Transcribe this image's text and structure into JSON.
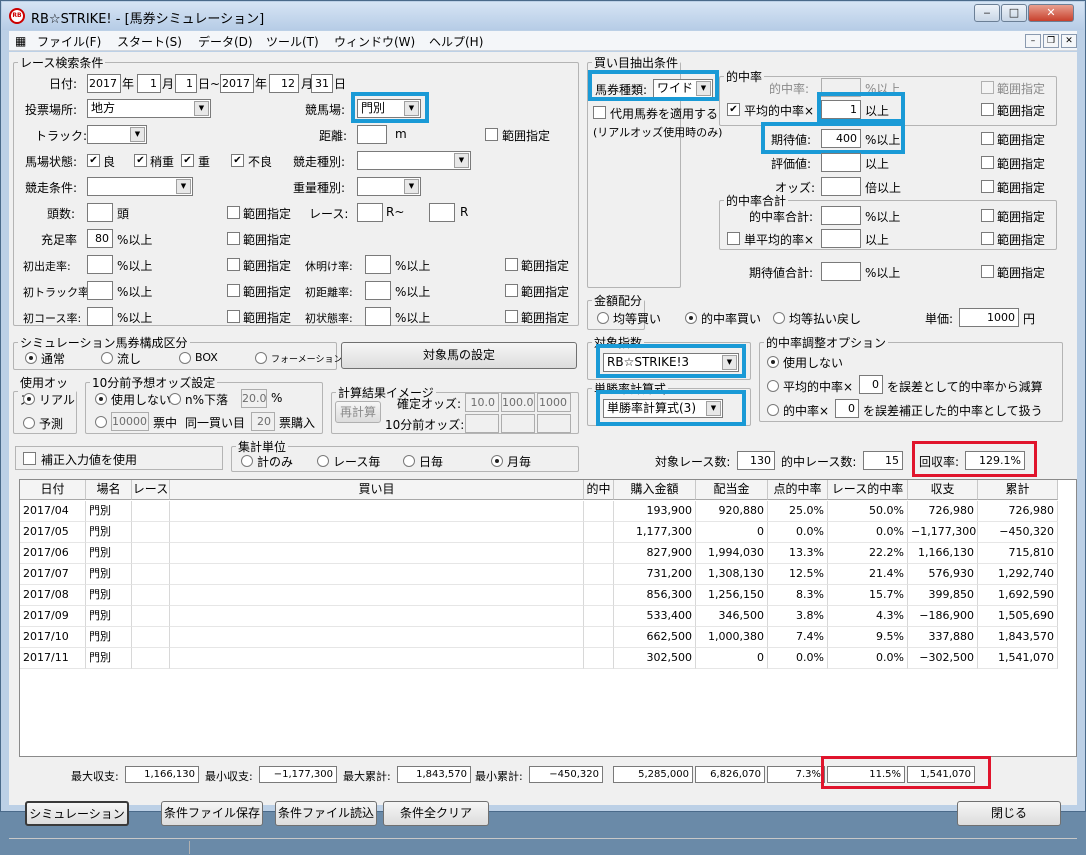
{
  "window": {
    "title": "RB☆STRIKE! - [馬券シミュレーション]",
    "app_icon": "RB"
  },
  "menu": [
    "ファイル(F)",
    "スタート(S)",
    "データ(D)",
    "ツール(T)",
    "ウィンドウ(W)",
    "ヘルプ(H)"
  ],
  "race": {
    "legend": "レース検索条件",
    "date_label": "日付:",
    "from_year": "2017",
    "from_month": "1",
    "from_day": "1",
    "to_year": "2017",
    "to_month": "12",
    "to_day": "31",
    "year": "年",
    "month": "月",
    "day_to": "日~",
    "day": "日",
    "venue_type_label": "投票場所:",
    "venue_type": "地方",
    "course_label": "競馬場:",
    "course": "門別",
    "track_label": "トラック:",
    "distance_label": "距離:",
    "meter": "m",
    "range": "範囲指定",
    "cond_label": "馬場状態:",
    "cond": [
      "良",
      "稍重",
      "重",
      "不良"
    ],
    "kind_label": "競走種別:",
    "terms_label": "競走条件:",
    "weight_label": "重量種別:",
    "heads_label": "頭数:",
    "heads_unit": "頭",
    "race_label": "レース:",
    "r_tilde": "R~",
    "r": "R",
    "fill_label": "充足率",
    "fill_value": "80",
    "pct_over": "%以上",
    "rest_label": "休明け率:",
    "first_run": "初出走率:",
    "first_track": "初トラック率:",
    "first_dist": "初距離率:",
    "first_course": "初コース率:",
    "first_cond": "初状態率:"
  },
  "buy": {
    "legend": "買い目抽出条件",
    "bet_type_label": "馬券種類:",
    "bet_type": "ワイド",
    "substitute": "代用馬券を適用する",
    "substitute_note": "(リアルオッズ使用時のみ)"
  },
  "hit": {
    "legend": "的中率",
    "hit_rate": "的中率:",
    "pct_over": "%以上",
    "range": "範囲指定",
    "avg_hit": "平均的中率×",
    "avg_hit_value": "1",
    "over": "以上",
    "expect": "期待値:",
    "expect_value": "400",
    "eval": "評価値:",
    "odds": "オッズ:",
    "times_over": "倍以上",
    "sum_legend": "的中率合計",
    "sum_label": "的中率合計:",
    "single_avg": "単平均的率×",
    "expect_sum": "期待値合計:"
  },
  "sim": {
    "legend": "シミュレーション馬券構成区分",
    "options": [
      "通常",
      "流し",
      "BOX",
      "フォーメーション"
    ],
    "target_btn": "対象馬の設定"
  },
  "money": {
    "legend": "金額配分",
    "options": [
      "均等買い",
      "的中率買い",
      "均等払い戻し"
    ],
    "unit_label": "単価:",
    "unit_value": "1000",
    "yen": "円"
  },
  "target": {
    "legend": "対象指数",
    "value": "RB☆STRIKE!3"
  },
  "formula": {
    "legend": "単勝率計算式",
    "value": "単勝率計算式(3)"
  },
  "adjust": {
    "legend": "的中率調整オプション",
    "none": "使用しない",
    "opt1a": "平均的中率×",
    "opt1b": "を誤差として的中率から減算",
    "opt2a": "的中率×",
    "opt2b": "を誤差補正した的中率として扱う",
    "v": "0"
  },
  "odds_use": {
    "legend": "使用オッズ",
    "real": "リアル",
    "pred": "予測"
  },
  "odds10": {
    "legend": "10分前予想オッズ設定",
    "none": "使用しない",
    "drop": "n%下落",
    "drop_val": "20.0",
    "pct": "%",
    "amount": "10000",
    "ticket": "票中",
    "same": "同一買い目",
    "same_val": "20",
    "buy": "票購入"
  },
  "calc": {
    "legend": "計算結果イメージ",
    "recalc": "再計算",
    "fixed": "確定オッズ:",
    "v1": "10.0",
    "v2": "100.0",
    "v3": "1000",
    "ten": "10分前オッズ:"
  },
  "correct": "補正入力値を使用",
  "agg": {
    "legend": "集計単位",
    "options": [
      "計のみ",
      "レース毎",
      "日毎",
      "月毎"
    ]
  },
  "counts": {
    "target_label": "対象レース数:",
    "target": "130",
    "hit_label": "的中レース数:",
    "hit": "15",
    "rr_label": "回収率:",
    "rr": "129.1%"
  },
  "table": {
    "headers": [
      "日付",
      "場名",
      "レース",
      "買い目",
      "的中",
      "購入金額",
      "配当金",
      "点的中率",
      "レース的中率",
      "収支",
      "累計"
    ],
    "rows": [
      [
        "2017/04",
        "門別",
        "",
        "",
        "",
        "193,900",
        "920,880",
        "25.0%",
        "50.0%",
        "726,980",
        "726,980"
      ],
      [
        "2017/05",
        "門別",
        "",
        "",
        "",
        "1,177,300",
        "0",
        "0.0%",
        "0.0%",
        "−1,177,300",
        "−450,320"
      ],
      [
        "2017/06",
        "門別",
        "",
        "",
        "",
        "827,900",
        "1,994,030",
        "13.3%",
        "22.2%",
        "1,166,130",
        "715,810"
      ],
      [
        "2017/07",
        "門別",
        "",
        "",
        "",
        "731,200",
        "1,308,130",
        "12.5%",
        "21.4%",
        "576,930",
        "1,292,740"
      ],
      [
        "2017/08",
        "門別",
        "",
        "",
        "",
        "856,300",
        "1,256,150",
        "8.3%",
        "15.7%",
        "399,850",
        "1,692,590"
      ],
      [
        "2017/09",
        "門別",
        "",
        "",
        "",
        "533,400",
        "346,500",
        "3.8%",
        "4.3%",
        "−186,900",
        "1,505,690"
      ],
      [
        "2017/10",
        "門別",
        "",
        "",
        "",
        "662,500",
        "1,000,380",
        "7.4%",
        "9.5%",
        "337,880",
        "1,843,570"
      ],
      [
        "2017/11",
        "門別",
        "",
        "",
        "",
        "302,500",
        "0",
        "0.0%",
        "0.0%",
        "−302,500",
        "1,541,070"
      ]
    ]
  },
  "summary": {
    "max_income_label": "最大収支:",
    "max_income": "1,166,130",
    "min_income_label": "最小収支:",
    "min_income": "−1,177,300",
    "max_cum_label": "最大累計:",
    "max_cum": "1,843,570",
    "min_cum_label": "最小累計:",
    "min_cum": "−450,320",
    "buy_total": "5,285,000",
    "pay_total": "6,826,070",
    "point_hit": "7.3%",
    "race_hit": "11.5%",
    "cum": "1,541,070"
  },
  "buttons": {
    "simulate": "シミュレーション",
    "save": "条件ファイル保存",
    "load": "条件ファイル読込",
    "clear": "条件全クリア",
    "close": "閉じる"
  }
}
